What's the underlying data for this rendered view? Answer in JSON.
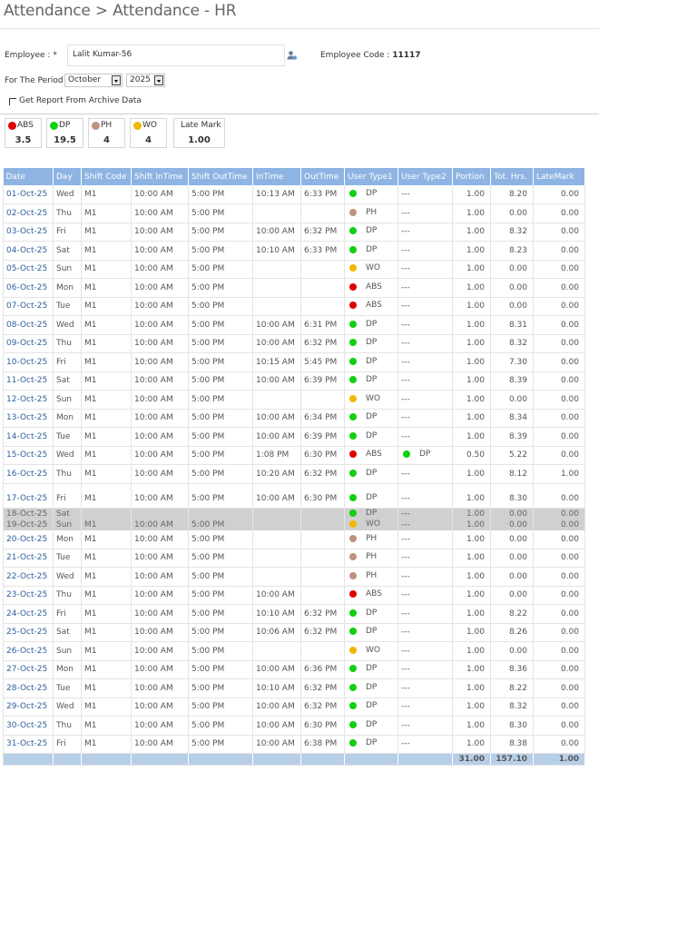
{
  "page": {
    "title": "Attendance > Attendance - HR"
  },
  "form": {
    "employee_label": "Employee : *",
    "employee_value": "Lalit Kumar-56",
    "employee_code_label": "Employee Code : ",
    "employee_code_value": "11117",
    "period_label": "For The Period",
    "month": "October",
    "year": "2025",
    "archive_label": "Get Report From Archive Data"
  },
  "summary": [
    {
      "label": "ABS",
      "value": "3.5",
      "color": "#e00000"
    },
    {
      "label": "DP",
      "value": "19.5",
      "color": "#10d010"
    },
    {
      "label": "PH",
      "value": "4",
      "color": "#c09080"
    },
    {
      "label": "WO",
      "value": "4",
      "color": "#f0b800"
    },
    {
      "label": "Late Mark",
      "value": "1.00",
      "color": ""
    }
  ],
  "colors": {
    "ABS": "#e00000",
    "DP": "#10d010",
    "PH": "#c09080",
    "WO": "#f0b800"
  },
  "table": {
    "headers": [
      "Date",
      "Day",
      "Shift Code",
      "Shift InTime",
      "Shift OutTime",
      "InTime",
      "OutTime",
      "User Type1",
      "User Type2",
      "Portion",
      "Tot. Hrs.",
      "LateMark"
    ],
    "rows": [
      {
        "date": "01-Oct-25",
        "day": "Wed",
        "shift": "M1",
        "sin": "10:00 AM",
        "sout": "5:00 PM",
        "in": "10:13 AM",
        "out": "6:33 PM",
        "ut1": "DP",
        "ut2": "---",
        "portion": "1.00",
        "hrs": "8.20",
        "late": "0.00"
      },
      {
        "date": "02-Oct-25",
        "day": "Thu",
        "shift": "M1",
        "sin": "10:00 AM",
        "sout": "5:00 PM",
        "in": "",
        "out": "",
        "ut1": "PH",
        "ut2": "---",
        "portion": "1.00",
        "hrs": "0.00",
        "late": "0.00"
      },
      {
        "date": "03-Oct-25",
        "day": "Fri",
        "shift": "M1",
        "sin": "10:00 AM",
        "sout": "5:00 PM",
        "in": "10:00 AM",
        "out": "6:32 PM",
        "ut1": "DP",
        "ut2": "---",
        "portion": "1.00",
        "hrs": "8.32",
        "late": "0.00"
      },
      {
        "date": "04-Oct-25",
        "day": "Sat",
        "shift": "M1",
        "sin": "10:00 AM",
        "sout": "5:00 PM",
        "in": "10:10 AM",
        "out": "6:33 PM",
        "ut1": "DP",
        "ut2": "---",
        "portion": "1.00",
        "hrs": "8.23",
        "late": "0.00"
      },
      {
        "date": "05-Oct-25",
        "day": "Sun",
        "shift": "M1",
        "sin": "10:00 AM",
        "sout": "5:00 PM",
        "in": "",
        "out": "",
        "ut1": "WO",
        "ut2": "---",
        "portion": "1.00",
        "hrs": "0.00",
        "late": "0.00"
      },
      {
        "date": "06-Oct-25",
        "day": "Mon",
        "shift": "M1",
        "sin": "10:00 AM",
        "sout": "5:00 PM",
        "in": "",
        "out": "",
        "ut1": "ABS",
        "ut2": "---",
        "portion": "1.00",
        "hrs": "0.00",
        "late": "0.00"
      },
      {
        "date": "07-Oct-25",
        "day": "Tue",
        "shift": "M1",
        "sin": "10:00 AM",
        "sout": "5:00 PM",
        "in": "",
        "out": "",
        "ut1": "ABS",
        "ut2": "---",
        "portion": "1.00",
        "hrs": "0.00",
        "late": "0.00"
      },
      {
        "date": "08-Oct-25",
        "day": "Wed",
        "shift": "M1",
        "sin": "10:00 AM",
        "sout": "5:00 PM",
        "in": "10:00 AM",
        "out": "6:31 PM",
        "ut1": "DP",
        "ut2": "---",
        "portion": "1.00",
        "hrs": "8.31",
        "late": "0.00"
      },
      {
        "date": "09-Oct-25",
        "day": "Thu",
        "shift": "M1",
        "sin": "10:00 AM",
        "sout": "5:00 PM",
        "in": "10:00 AM",
        "out": "6:32 PM",
        "ut1": "DP",
        "ut2": "---",
        "portion": "1.00",
        "hrs": "8.32",
        "late": "0.00"
      },
      {
        "date": "10-Oct-25",
        "day": "Fri",
        "shift": "M1",
        "sin": "10:00 AM",
        "sout": "5:00 PM",
        "in": "10:15 AM",
        "out": "5:45 PM",
        "ut1": "DP",
        "ut2": "---",
        "portion": "1.00",
        "hrs": "7.30",
        "late": "0.00"
      },
      {
        "date": "11-Oct-25",
        "day": "Sat",
        "shift": "M1",
        "sin": "10:00 AM",
        "sout": "5:00 PM",
        "in": "10:00 AM",
        "out": "6:39 PM",
        "ut1": "DP",
        "ut2": "---",
        "portion": "1.00",
        "hrs": "8.39",
        "late": "0.00"
      },
      {
        "date": "12-Oct-25",
        "day": "Sun",
        "shift": "M1",
        "sin": "10:00 AM",
        "sout": "5:00 PM",
        "in": "",
        "out": "",
        "ut1": "WO",
        "ut2": "---",
        "portion": "1.00",
        "hrs": "0.00",
        "late": "0.00"
      },
      {
        "date": "13-Oct-25",
        "day": "Mon",
        "shift": "M1",
        "sin": "10:00 AM",
        "sout": "5:00 PM",
        "in": "10:00 AM",
        "out": "6:34 PM",
        "ut1": "DP",
        "ut2": "---",
        "portion": "1.00",
        "hrs": "8.34",
        "late": "0.00"
      },
      {
        "date": "14-Oct-25",
        "day": "Tue",
        "shift": "M1",
        "sin": "10:00 AM",
        "sout": "5:00 PM",
        "in": "10:00 AM",
        "out": "6:39 PM",
        "ut1": "DP",
        "ut2": "---",
        "portion": "1.00",
        "hrs": "8.39",
        "late": "0.00"
      },
      {
        "date": "15-Oct-25",
        "day": "Wed",
        "shift": "M1",
        "sin": "10:00 AM",
        "sout": "5:00 PM",
        "in": "1:08 PM",
        "out": "6:30 PM",
        "ut1": "ABS",
        "ut2": "DP",
        "portion": "0.50",
        "hrs": "5.22",
        "late": "0.00"
      },
      {
        "date": "16-Oct-25",
        "day": "Thu",
        "shift": "M1",
        "sin": "10:00 AM",
        "sout": "5:00 PM",
        "in": "10:20 AM",
        "out": "6:32 PM",
        "ut1": "DP",
        "ut2": "---",
        "portion": "1.00",
        "hrs": "8.12",
        "late": "1.00"
      },
      {
        "date": "17-Oct-25",
        "day": "Fri",
        "shift": "M1",
        "sin": "10:00 AM",
        "sout": "5:00 PM",
        "in": "10:00 AM",
        "out": "6:30 PM",
        "ut1": "DP",
        "ut2": "---",
        "portion": "1.00",
        "hrs": "8.30",
        "late": "0.00",
        "gap": true
      },
      {
        "date": "18-Oct-25",
        "day": "Sat",
        "shift": "",
        "sin": "",
        "sout": "",
        "in": "",
        "out": "",
        "ut1": "DP",
        "ut2": "---",
        "portion": "1.00",
        "hrs": "0.00",
        "late": "0.00",
        "hl": true
      },
      {
        "date": "19-Oct-25",
        "day": "Sun",
        "shift": "M1",
        "sin": "10:00 AM",
        "sout": "5:00 PM",
        "in": "",
        "out": "",
        "ut1": "WO",
        "ut2": "---",
        "portion": "1.00",
        "hrs": "0.00",
        "late": "0.00",
        "hl": true
      },
      {
        "date": "20-Oct-25",
        "day": "Mon",
        "shift": "M1",
        "sin": "10:00 AM",
        "sout": "5:00 PM",
        "in": "",
        "out": "",
        "ut1": "PH",
        "ut2": "---",
        "portion": "1.00",
        "hrs": "0.00",
        "late": "0.00"
      },
      {
        "date": "21-Oct-25",
        "day": "Tue",
        "shift": "M1",
        "sin": "10:00 AM",
        "sout": "5:00 PM",
        "in": "",
        "out": "",
        "ut1": "PH",
        "ut2": "---",
        "portion": "1.00",
        "hrs": "0.00",
        "late": "0.00"
      },
      {
        "date": "22-Oct-25",
        "day": "Wed",
        "shift": "M1",
        "sin": "10:00 AM",
        "sout": "5:00 PM",
        "in": "",
        "out": "",
        "ut1": "PH",
        "ut2": "---",
        "portion": "1.00",
        "hrs": "0.00",
        "late": "0.00"
      },
      {
        "date": "23-Oct-25",
        "day": "Thu",
        "shift": "M1",
        "sin": "10:00 AM",
        "sout": "5:00 PM",
        "in": "10:00 AM",
        "out": "",
        "ut1": "ABS",
        "ut2": "---",
        "portion": "1.00",
        "hrs": "0.00",
        "late": "0.00"
      },
      {
        "date": "24-Oct-25",
        "day": "Fri",
        "shift": "M1",
        "sin": "10:00 AM",
        "sout": "5:00 PM",
        "in": "10:10 AM",
        "out": "6:32 PM",
        "ut1": "DP",
        "ut2": "---",
        "portion": "1.00",
        "hrs": "8.22",
        "late": "0.00"
      },
      {
        "date": "25-Oct-25",
        "day": "Sat",
        "shift": "M1",
        "sin": "10:00 AM",
        "sout": "5:00 PM",
        "in": "10:06 AM",
        "out": "6:32 PM",
        "ut1": "DP",
        "ut2": "---",
        "portion": "1.00",
        "hrs": "8.26",
        "late": "0.00"
      },
      {
        "date": "26-Oct-25",
        "day": "Sun",
        "shift": "M1",
        "sin": "10:00 AM",
        "sout": "5:00 PM",
        "in": "",
        "out": "",
        "ut1": "WO",
        "ut2": "---",
        "portion": "1.00",
        "hrs": "0.00",
        "late": "0.00"
      },
      {
        "date": "27-Oct-25",
        "day": "Mon",
        "shift": "M1",
        "sin": "10:00 AM",
        "sout": "5:00 PM",
        "in": "10:00 AM",
        "out": "6:36 PM",
        "ut1": "DP",
        "ut2": "---",
        "portion": "1.00",
        "hrs": "8.36",
        "late": "0.00"
      },
      {
        "date": "28-Oct-25",
        "day": "Tue",
        "shift": "M1",
        "sin": "10:00 AM",
        "sout": "5:00 PM",
        "in": "10:10 AM",
        "out": "6:32 PM",
        "ut1": "DP",
        "ut2": "---",
        "portion": "1.00",
        "hrs": "8.22",
        "late": "0.00"
      },
      {
        "date": "29-Oct-25",
        "day": "Wed",
        "shift": "M1",
        "sin": "10:00 AM",
        "sout": "5:00 PM",
        "in": "10:00 AM",
        "out": "6:32 PM",
        "ut1": "DP",
        "ut2": "---",
        "portion": "1.00",
        "hrs": "8.32",
        "late": "0.00"
      },
      {
        "date": "30-Oct-25",
        "day": "Thu",
        "shift": "M1",
        "sin": "10:00 AM",
        "sout": "5:00 PM",
        "in": "10:00 AM",
        "out": "6:30 PM",
        "ut1": "DP",
        "ut2": "---",
        "portion": "1.00",
        "hrs": "8.30",
        "late": "0.00"
      },
      {
        "date": "31-Oct-25",
        "day": "Fri",
        "shift": "M1",
        "sin": "10:00 AM",
        "sout": "5:00 PM",
        "in": "10:00 AM",
        "out": "6:38 PM",
        "ut1": "DP",
        "ut2": "---",
        "portion": "1.00",
        "hrs": "8.38",
        "late": "0.00"
      }
    ],
    "totals": {
      "portion": "31.00",
      "hrs": "157.10",
      "late": "1.00"
    }
  }
}
